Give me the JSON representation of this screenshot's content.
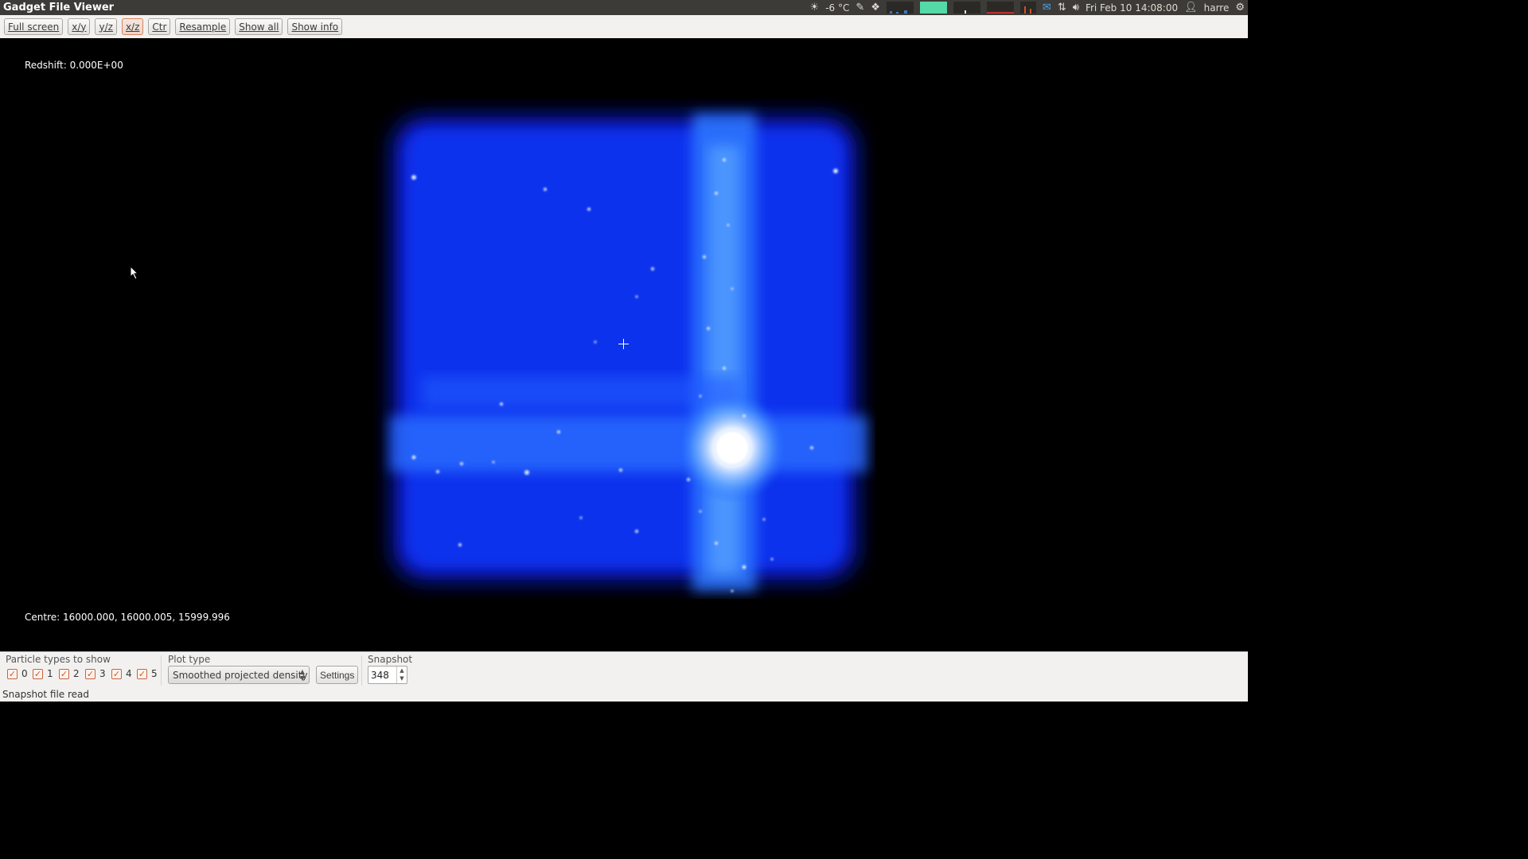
{
  "window": {
    "title": "Gadget File Viewer"
  },
  "tray": {
    "weather": "-6 °C",
    "clock": "Fri Feb 10 14:08:00",
    "user": "harre",
    "icons": [
      "weather-icon",
      "notes-icon",
      "dropbox-icon",
      "cpu-graph",
      "memory-graph",
      "network-graph",
      "disk-graph",
      "mail-icon",
      "network-icon",
      "volume-icon",
      "user-icon",
      "gear-icon"
    ]
  },
  "toolbar": {
    "fullscreen": "Full screen",
    "xy": "x/y",
    "yz": "y/z",
    "xz": "x/z",
    "ctr": "Ctr",
    "resample": "Resample",
    "show_all": "Show all",
    "show_info": "Show info",
    "active": "x/z"
  },
  "view": {
    "redshift": "Redshift: 0.000E+00",
    "centre": "Centre: 16000.000, 16000.005, 15999.996"
  },
  "controls": {
    "particle_label": "Particle types to show",
    "particle_types": [
      {
        "label": "0",
        "checked": true
      },
      {
        "label": "1",
        "checked": true
      },
      {
        "label": "2",
        "checked": true
      },
      {
        "label": "3",
        "checked": true
      },
      {
        "label": "4",
        "checked": true
      },
      {
        "label": "5",
        "checked": true
      }
    ],
    "plot_type_label": "Plot type",
    "plot_type_value": "Smoothed projected density",
    "settings": "Settings",
    "snapshot_label": "Snapshot",
    "snapshot_value": "348"
  },
  "status": {
    "message": "Snapshot file read"
  },
  "colors": {
    "accent": "#e0805a",
    "density_blue": "#0a3cff",
    "panel": "#3c3b37"
  }
}
